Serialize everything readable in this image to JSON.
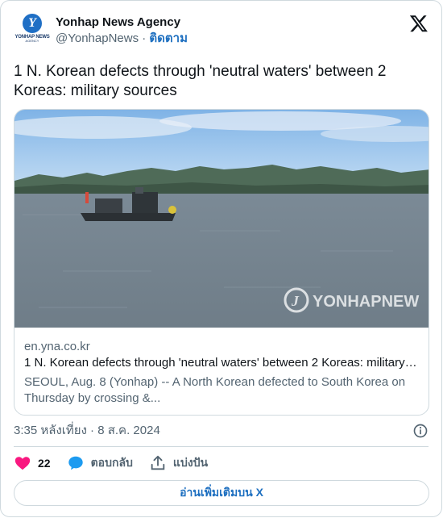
{
  "account": {
    "display_name": "Yonhap News Agency",
    "handle": "@YonhapNews",
    "separator": " · ",
    "follow_label": "ติดตาม",
    "avatar_text": "YONHAP NEWS",
    "avatar_subtext": "AGENCY",
    "avatar_mark": "Y"
  },
  "tweet": {
    "text": "1 N. Korean defects through 'neutral waters' between 2 Koreas: military sources",
    "timestamp": "3:35 หลังเที่ยง · 8 ส.ค. 2024"
  },
  "link_card": {
    "image_description_icon": "photo-boat-river",
    "watermark": "YONHAPNEW",
    "domain": "en.yna.co.kr",
    "title": "1 N. Korean defects through 'neutral waters' between 2 Koreas: military s...",
    "description": "SEOUL, Aug. 8 (Yonhap) -- A North Korean defected to South Korea on Thursday by crossing &..."
  },
  "actions": {
    "like_count": "22",
    "reply_label": "ตอบกลับ",
    "share_label": "แบ่งปัน"
  },
  "read_more_label": "อ่านเพิ่มเติมบน X",
  "colors": {
    "accent": "#1d6fc0",
    "like": "#f91880",
    "reply": "#1d9bf0",
    "border": "#cfd9de",
    "secondary_text": "#536471"
  }
}
